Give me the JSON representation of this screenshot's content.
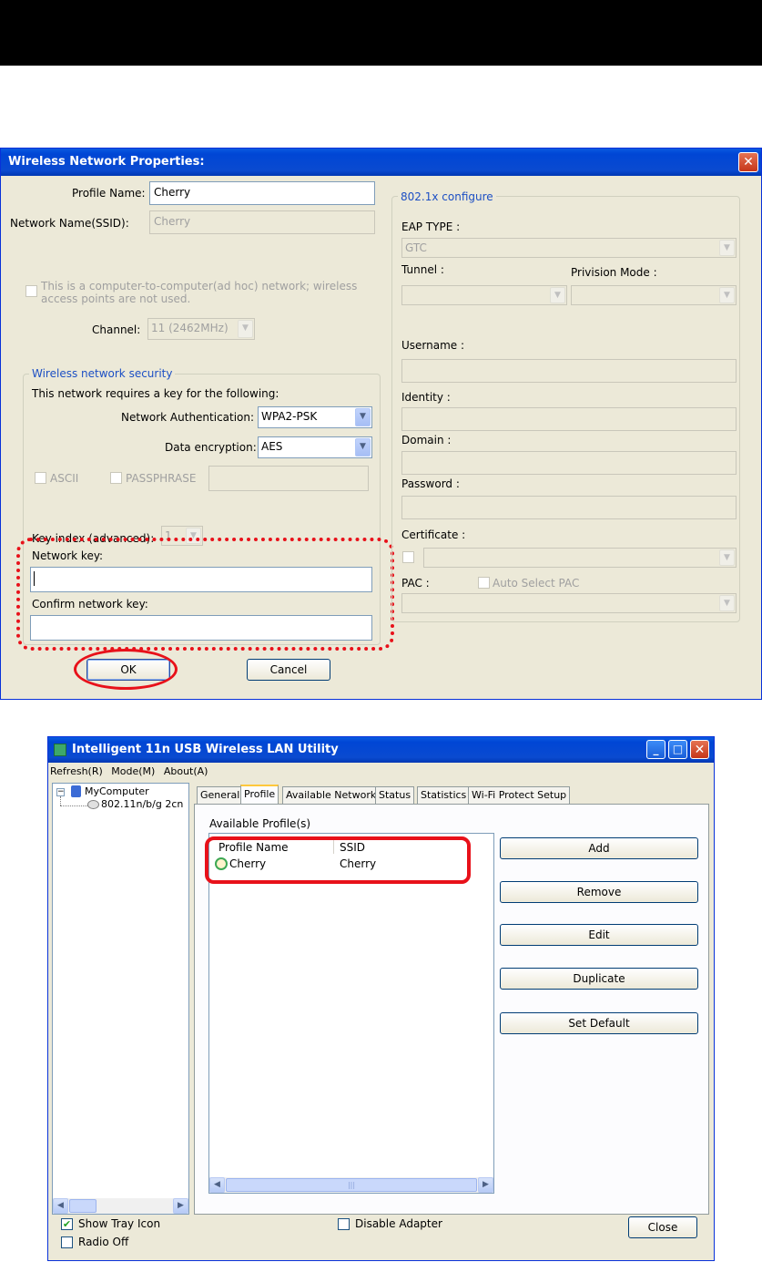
{
  "properties_dialog": {
    "title": "Wireless Network Properties:",
    "close_glyph": "✕",
    "profile_name_label": "Profile Name:",
    "profile_name_value": "Cherry",
    "ssid_label": "Network Name(SSID):",
    "ssid_value": "Cherry",
    "adhoc_text_1": "This is a computer-to-computer(ad hoc) network; wireless",
    "adhoc_text_2": "access points are not used.",
    "channel_label": "Channel:",
    "channel_value": "11 (2462MHz)",
    "security_group_title": "Wireless network security",
    "security_requires_text": "This network requires a key for the following:",
    "auth_label": "Network Authentication:",
    "auth_value": "WPA2-PSK",
    "encryption_label": "Data encryption:",
    "encryption_value": "AES",
    "ascii_label": "ASCII",
    "passphrase_label": "PASSPHRASE",
    "key_index_label": "Key index (advanced):",
    "key_index_value": "1",
    "network_key_label": "Network key:",
    "network_key_value": "",
    "confirm_key_label": "Confirm network key:",
    "confirm_key_value": "",
    "ok_label": "OK",
    "cancel_label": "Cancel",
    "dot1x": {
      "title": "802.1x configure",
      "eap_type_label": "EAP TYPE :",
      "eap_type_value": "GTC",
      "tunnel_label": "Tunnel :",
      "provision_mode_label": "Privision Mode :",
      "username_label": "Username :",
      "identity_label": "Identity :",
      "domain_label": "Domain :",
      "password_label": "Password :",
      "certificate_label": "Certificate :",
      "pac_label": "PAC :",
      "auto_select_pac_label": "Auto Select PAC"
    }
  },
  "utility_window": {
    "title": "Intelligent 11n USB Wireless LAN Utility",
    "menu": [
      "Refresh(R)",
      "Mode(M)",
      "About(A)"
    ],
    "tree": {
      "root": "MyComputer",
      "adapter": "802.11n/b/g 2cn"
    },
    "tabs": [
      "General",
      "Profile",
      "Available Network",
      "Status",
      "Statistics",
      "Wi-Fi Protect Setup"
    ],
    "selected_tab": "Profile",
    "available_profiles_label": "Available Profile(s)",
    "columns": [
      "Profile Name",
      "SSID"
    ],
    "profiles": [
      {
        "name": "Cherry",
        "ssid": "Cherry"
      }
    ],
    "buttons": [
      "Add",
      "Remove",
      "Edit",
      "Duplicate",
      "Set Default"
    ],
    "show_tray_icon_label": "Show Tray Icon",
    "show_tray_icon_checked": true,
    "radio_off_label": "Radio Off",
    "disable_adapter_label": "Disable Adapter",
    "close_label": "Close"
  },
  "colors": {
    "annotation_red": "#e8111a",
    "xp_title_blue": "#0046d5",
    "dialog_face": "#ece9d8"
  }
}
